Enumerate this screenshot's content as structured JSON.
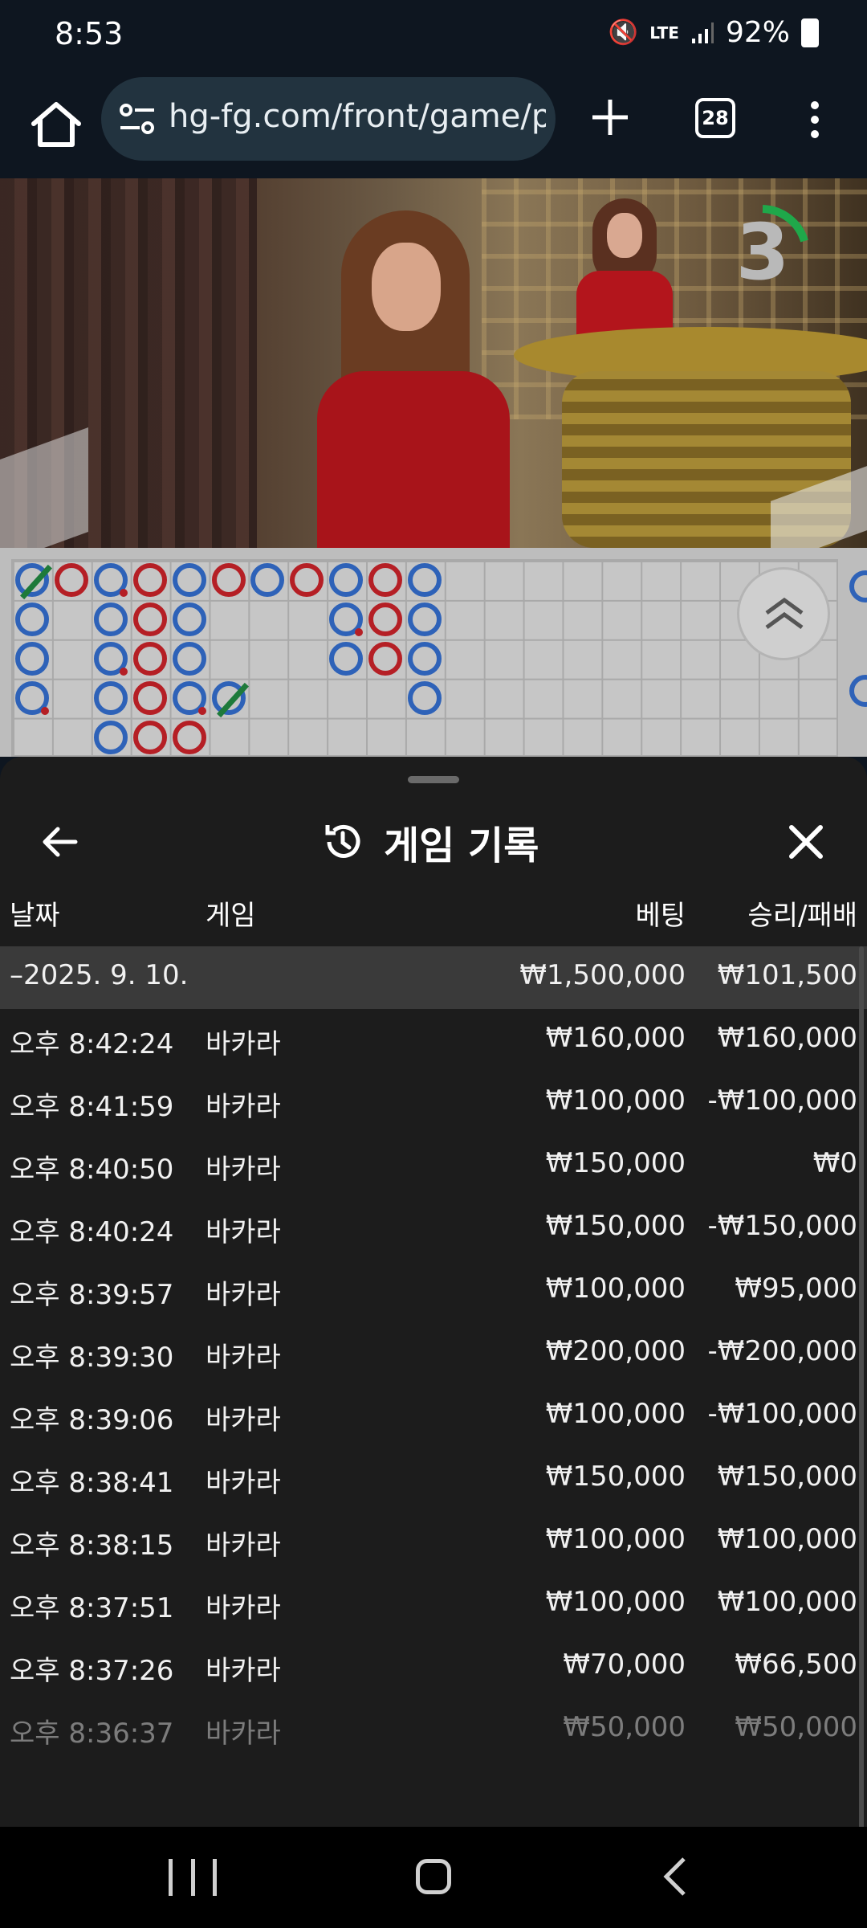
{
  "status_bar": {
    "time": "8:53",
    "network": "LTE",
    "battery": "92%"
  },
  "browser": {
    "url": "hg-fg.com/front/game/p",
    "tab_count": "28"
  },
  "video": {
    "countdown": "3"
  },
  "sheet": {
    "title": "게임 기록",
    "columns": {
      "date": "날짜",
      "game": "게임",
      "bet": "베팅",
      "result": "승리/패배"
    },
    "summary": {
      "date": "–2025. 9. 10.",
      "bet": "₩1,500,000",
      "result": "₩101,500"
    },
    "rows": [
      {
        "time": "오후 8:42:24",
        "game": "바카라",
        "bet": "₩160,000",
        "result": "₩160,000"
      },
      {
        "time": "오후 8:41:59",
        "game": "바카라",
        "bet": "₩100,000",
        "result": "-₩100,000"
      },
      {
        "time": "오후 8:40:50",
        "game": "바카라",
        "bet": "₩150,000",
        "result": "₩0"
      },
      {
        "time": "오후 8:40:24",
        "game": "바카라",
        "bet": "₩150,000",
        "result": "-₩150,000"
      },
      {
        "time": "오후 8:39:57",
        "game": "바카라",
        "bet": "₩100,000",
        "result": "₩95,000"
      },
      {
        "time": "오후 8:39:30",
        "game": "바카라",
        "bet": "₩200,000",
        "result": "-₩200,000"
      },
      {
        "time": "오후 8:39:06",
        "game": "바카라",
        "bet": "₩100,000",
        "result": "-₩100,000"
      },
      {
        "time": "오후 8:38:41",
        "game": "바카라",
        "bet": "₩150,000",
        "result": "₩150,000"
      },
      {
        "time": "오후 8:38:15",
        "game": "바카라",
        "bet": "₩100,000",
        "result": "₩100,000"
      },
      {
        "time": "오후 8:37:51",
        "game": "바카라",
        "bet": "₩100,000",
        "result": "₩100,000"
      },
      {
        "time": "오후 8:37:26",
        "game": "바카라",
        "bet": "₩70,000",
        "result": "₩66,500"
      },
      {
        "time": "오후 8:36:37",
        "game": "바카라",
        "bet": "₩50,000",
        "result": "₩50,000"
      }
    ]
  },
  "colors": {
    "player_blue": "#2e62b8",
    "banker_red": "#b51f25",
    "tie_green": "#1e7a3a",
    "sheet_bg": "#1c1c1c"
  }
}
